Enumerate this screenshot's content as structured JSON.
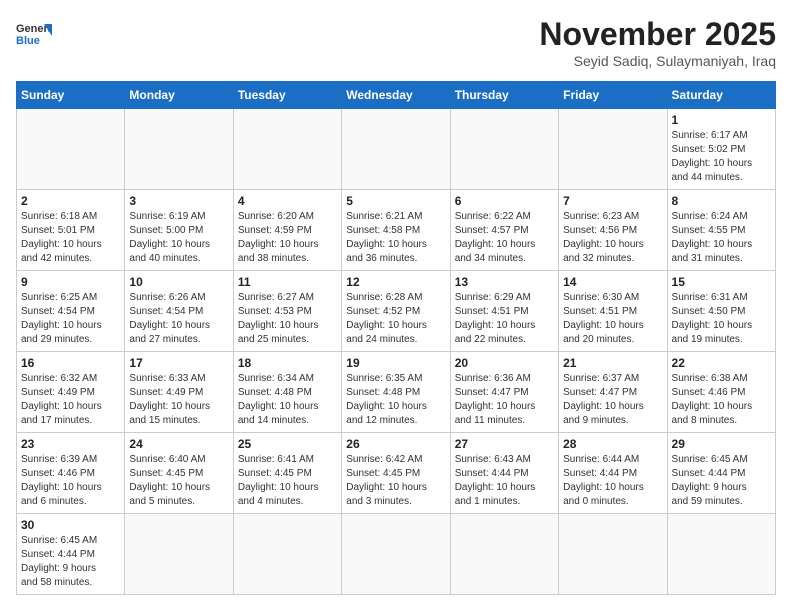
{
  "header": {
    "logo_general": "General",
    "logo_blue": "Blue",
    "month_title": "November 2025",
    "subtitle": "Seyid Sadiq, Sulaymaniyah, Iraq"
  },
  "weekdays": [
    "Sunday",
    "Monday",
    "Tuesday",
    "Wednesday",
    "Thursday",
    "Friday",
    "Saturday"
  ],
  "days": [
    {
      "date": 1,
      "sunrise": "6:17 AM",
      "sunset": "5:02 PM",
      "daylight_hours": 10,
      "daylight_minutes": 44
    },
    {
      "date": 2,
      "sunrise": "6:18 AM",
      "sunset": "5:01 PM",
      "daylight_hours": 10,
      "daylight_minutes": 42
    },
    {
      "date": 3,
      "sunrise": "6:19 AM",
      "sunset": "5:00 PM",
      "daylight_hours": 10,
      "daylight_minutes": 40
    },
    {
      "date": 4,
      "sunrise": "6:20 AM",
      "sunset": "4:59 PM",
      "daylight_hours": 10,
      "daylight_minutes": 38
    },
    {
      "date": 5,
      "sunrise": "6:21 AM",
      "sunset": "4:58 PM",
      "daylight_hours": 10,
      "daylight_minutes": 36
    },
    {
      "date": 6,
      "sunrise": "6:22 AM",
      "sunset": "4:57 PM",
      "daylight_hours": 10,
      "daylight_minutes": 34
    },
    {
      "date": 7,
      "sunrise": "6:23 AM",
      "sunset": "4:56 PM",
      "daylight_hours": 10,
      "daylight_minutes": 32
    },
    {
      "date": 8,
      "sunrise": "6:24 AM",
      "sunset": "4:55 PM",
      "daylight_hours": 10,
      "daylight_minutes": 31
    },
    {
      "date": 9,
      "sunrise": "6:25 AM",
      "sunset": "4:54 PM",
      "daylight_hours": 10,
      "daylight_minutes": 29
    },
    {
      "date": 10,
      "sunrise": "6:26 AM",
      "sunset": "4:54 PM",
      "daylight_hours": 10,
      "daylight_minutes": 27
    },
    {
      "date": 11,
      "sunrise": "6:27 AM",
      "sunset": "4:53 PM",
      "daylight_hours": 10,
      "daylight_minutes": 25
    },
    {
      "date": 12,
      "sunrise": "6:28 AM",
      "sunset": "4:52 PM",
      "daylight_hours": 10,
      "daylight_minutes": 24
    },
    {
      "date": 13,
      "sunrise": "6:29 AM",
      "sunset": "4:51 PM",
      "daylight_hours": 10,
      "daylight_minutes": 22
    },
    {
      "date": 14,
      "sunrise": "6:30 AM",
      "sunset": "4:51 PM",
      "daylight_hours": 10,
      "daylight_minutes": 20
    },
    {
      "date": 15,
      "sunrise": "6:31 AM",
      "sunset": "4:50 PM",
      "daylight_hours": 10,
      "daylight_minutes": 19
    },
    {
      "date": 16,
      "sunrise": "6:32 AM",
      "sunset": "4:49 PM",
      "daylight_hours": 10,
      "daylight_minutes": 17
    },
    {
      "date": 17,
      "sunrise": "6:33 AM",
      "sunset": "4:49 PM",
      "daylight_hours": 10,
      "daylight_minutes": 15
    },
    {
      "date": 18,
      "sunrise": "6:34 AM",
      "sunset": "4:48 PM",
      "daylight_hours": 10,
      "daylight_minutes": 14
    },
    {
      "date": 19,
      "sunrise": "6:35 AM",
      "sunset": "4:48 PM",
      "daylight_hours": 10,
      "daylight_minutes": 12
    },
    {
      "date": 20,
      "sunrise": "6:36 AM",
      "sunset": "4:47 PM",
      "daylight_hours": 10,
      "daylight_minutes": 11
    },
    {
      "date": 21,
      "sunrise": "6:37 AM",
      "sunset": "4:47 PM",
      "daylight_hours": 10,
      "daylight_minutes": 9
    },
    {
      "date": 22,
      "sunrise": "6:38 AM",
      "sunset": "4:46 PM",
      "daylight_hours": 10,
      "daylight_minutes": 8
    },
    {
      "date": 23,
      "sunrise": "6:39 AM",
      "sunset": "4:46 PM",
      "daylight_hours": 10,
      "daylight_minutes": 6
    },
    {
      "date": 24,
      "sunrise": "6:40 AM",
      "sunset": "4:45 PM",
      "daylight_hours": 10,
      "daylight_minutes": 5
    },
    {
      "date": 25,
      "sunrise": "6:41 AM",
      "sunset": "4:45 PM",
      "daylight_hours": 10,
      "daylight_minutes": 4
    },
    {
      "date": 26,
      "sunrise": "6:42 AM",
      "sunset": "4:45 PM",
      "daylight_hours": 10,
      "daylight_minutes": 3
    },
    {
      "date": 27,
      "sunrise": "6:43 AM",
      "sunset": "4:44 PM",
      "daylight_hours": 10,
      "daylight_minutes": 1
    },
    {
      "date": 28,
      "sunrise": "6:44 AM",
      "sunset": "4:44 PM",
      "daylight_hours": 10,
      "daylight_minutes": 0
    },
    {
      "date": 29,
      "sunrise": "6:45 AM",
      "sunset": "4:44 PM",
      "daylight_hours": 9,
      "daylight_minutes": 59
    },
    {
      "date": 30,
      "sunrise": "6:45 AM",
      "sunset": "4:44 PM",
      "daylight_hours": 9,
      "daylight_minutes": 58
    }
  ]
}
